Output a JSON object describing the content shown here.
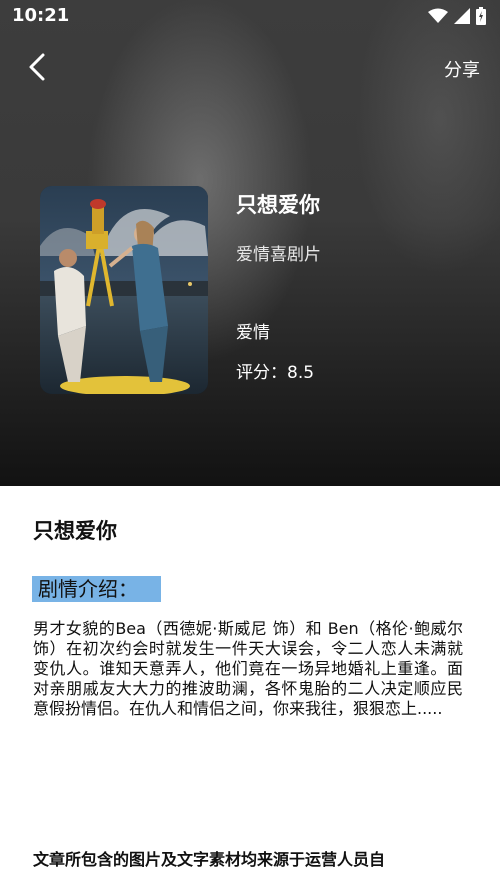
{
  "status_bar": {
    "time": "10:21",
    "icons": [
      "wifi-icon",
      "signal-icon",
      "battery-icon"
    ]
  },
  "header": {
    "back_icon": "chevron-left-icon",
    "share_label": "分享"
  },
  "movie": {
    "title": "只想爱你",
    "genre": "爱情喜剧片",
    "tag": "爱情",
    "rating": "评分：8.5"
  },
  "detail": {
    "title": "只想爱你",
    "section_label": "剧情介绍：",
    "description": "男才女貌的Bea（西德妮·斯威尼 饰）和 Ben（格伦·鲍威尔 饰）在初次约会时就发生一件天大误会，令二人恋人未满就变仇人。谁知天意弄人，他们竟在一场异地婚礼上重逢。面对亲朋戚友大大力的推波助澜，各怀鬼胎的二人决定顺应民意假扮情侣。在仇人和情侣之间，你来我往，狠狠恋上.....",
    "disclaimer": "文章所包含的图片及文字素材均来源于运营人员自"
  },
  "colors": {
    "highlight": "#78b3e6",
    "hero_bg": "#3a3a3a"
  }
}
